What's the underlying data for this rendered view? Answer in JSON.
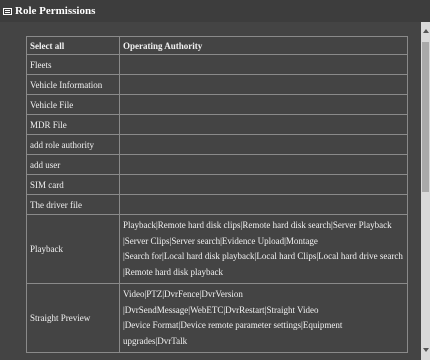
{
  "window": {
    "title": "Role Permissions",
    "icon": "grid-icon"
  },
  "table": {
    "headers": [
      "Select all",
      "Operating Authority"
    ],
    "rows": [
      {
        "name": "Fleets",
        "ops": []
      },
      {
        "name": "Vehicle Information",
        "ops": []
      },
      {
        "name": "Vehicle File",
        "ops": []
      },
      {
        "name": "MDR File",
        "ops": []
      },
      {
        "name": "add role authority",
        "ops": []
      },
      {
        "name": "add user",
        "ops": []
      },
      {
        "name": "SIM card",
        "ops": []
      },
      {
        "name": "The driver file",
        "ops": []
      },
      {
        "name": "Playback",
        "ops": [
          "Playback|Remote hard disk clips|Remote hard disk search|Server Playback",
          "|Server Clips|Server search|Evidence Upload|Montage",
          "|Search for|Local hard disk playback|Local hard Clips|Local hard drive search",
          "|Remote hard disk playback"
        ]
      },
      {
        "name": "Straight Preview",
        "ops": [
          "Video|PTZ|DvrFence|DvrVersion",
          "|DvrSendMessage|WebETC|DvrRestart|Straight Video",
          "|Device Format|Device remote parameter settings|Equipment upgrades|DvrTalk"
        ]
      }
    ]
  }
}
